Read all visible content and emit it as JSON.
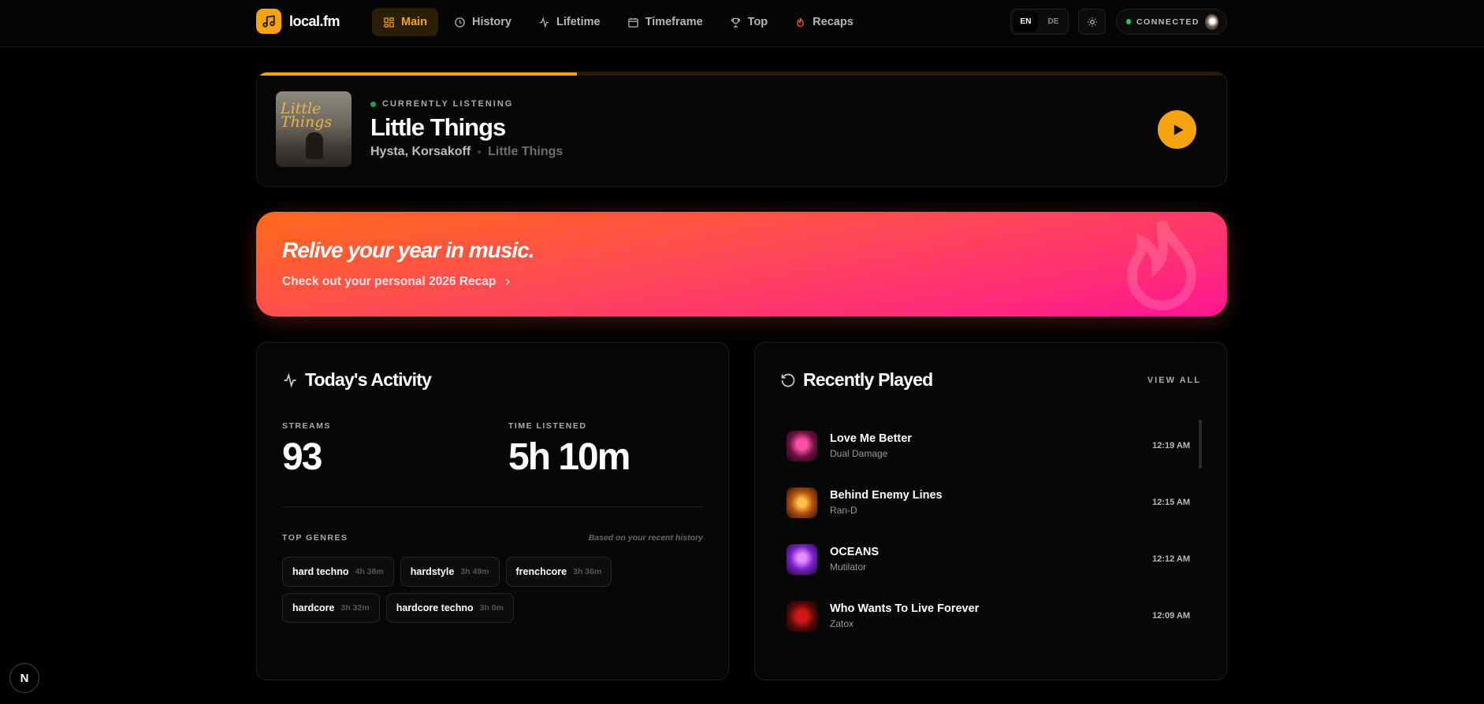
{
  "app": {
    "name": "local.fm"
  },
  "nav": {
    "items": [
      {
        "label": "Main",
        "icon": "grid-icon",
        "active": true
      },
      {
        "label": "History",
        "icon": "clock-icon",
        "active": false
      },
      {
        "label": "Lifetime",
        "icon": "activity-icon",
        "active": false
      },
      {
        "label": "Timeframe",
        "icon": "calendar-icon",
        "active": false
      },
      {
        "label": "Top",
        "icon": "trophy-icon",
        "active": false
      },
      {
        "label": "Recaps",
        "icon": "flame-icon",
        "active": false
      }
    ]
  },
  "language": {
    "options": [
      "EN",
      "DE"
    ],
    "selected": "EN"
  },
  "connection": {
    "status": "CONNECTED",
    "color": "#22c55e"
  },
  "now_playing": {
    "label": "CURRENTLY LISTENING",
    "title": "Little Things",
    "artist": "Hysta, Korsakoff",
    "album": "Little Things",
    "cover_text": "Little Things",
    "progress": 0.33
  },
  "banner": {
    "headline": "Relive your year in music.",
    "link": "Check out your personal 2026 Recap"
  },
  "activity": {
    "title": "Today's Activity",
    "streams_label": "STREAMS",
    "streams": "93",
    "time_label": "TIME LISTENED",
    "time": "5h 10m",
    "genres_label": "TOP GENRES",
    "genres_note": "Based on your recent history",
    "genres": [
      {
        "name": "hard techno",
        "time": "4h 38m"
      },
      {
        "name": "hardstyle",
        "time": "3h 49m"
      },
      {
        "name": "frenchcore",
        "time": "3h 36m"
      },
      {
        "name": "hardcore",
        "time": "3h 32m"
      },
      {
        "name": "hardcore techno",
        "time": "3h 0m"
      }
    ]
  },
  "recent": {
    "title": "Recently Played",
    "view_all": "VIEW ALL",
    "tracks": [
      {
        "title": "Love Me Better",
        "artist": "Dual Damage",
        "time": "12:19 AM"
      },
      {
        "title": "Behind Enemy Lines",
        "artist": "Ran-D",
        "time": "12:15 AM"
      },
      {
        "title": "OCEANS",
        "artist": "Mutilator",
        "time": "12:12 AM"
      },
      {
        "title": "Who Wants To Live Forever",
        "artist": "Zatox",
        "time": "12:09 AM"
      }
    ]
  },
  "colors": {
    "accent": "#f5a30f",
    "banner_start": "#ff6a1a",
    "banner_end": "#ff1493"
  }
}
